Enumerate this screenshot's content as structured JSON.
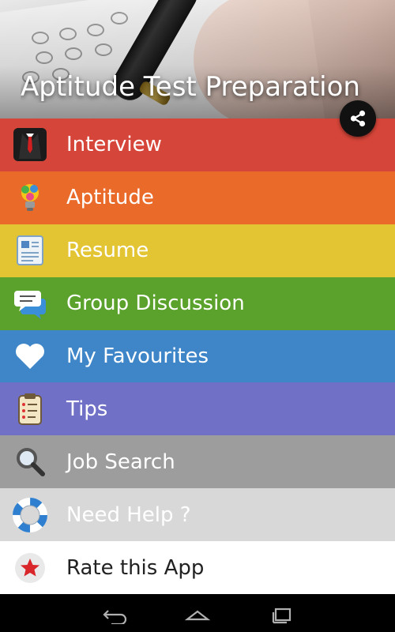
{
  "header": {
    "title": "Aptitude Test Preparation"
  },
  "menu": [
    {
      "label": "Interview",
      "icon": "suit-tie-icon",
      "bg": "#d64539",
      "text": "#ffffff"
    },
    {
      "label": "Aptitude",
      "icon": "lightbulb-icon",
      "bg": "#ea6a2a",
      "text": "#ffffff"
    },
    {
      "label": "Resume",
      "icon": "resume-document-icon",
      "bg": "#e3c432",
      "text": "#ffffff"
    },
    {
      "label": "Group Discussion",
      "icon": "chat-bubbles-icon",
      "bg": "#5aa22b",
      "text": "#ffffff"
    },
    {
      "label": "My Favourites",
      "icon": "heart-icon",
      "bg": "#3f86c9",
      "text": "#ffffff"
    },
    {
      "label": "Tips",
      "icon": "clipboard-icon",
      "bg": "#6f70c6",
      "text": "#ffffff"
    },
    {
      "label": "Job Search",
      "icon": "magnifier-icon",
      "bg": "#9d9d9d",
      "text": "#ffffff"
    },
    {
      "label": "Need Help ?",
      "icon": "lifebuoy-icon",
      "bg": "#d8d8d8",
      "text": "#ffffff"
    },
    {
      "label": "Rate this App",
      "icon": "star-badge-icon",
      "bg": "#ffffff",
      "text": "#222222"
    }
  ],
  "navbar": {
    "back_icon": "back-icon",
    "home_icon": "home-icon",
    "recents_icon": "recents-icon"
  }
}
